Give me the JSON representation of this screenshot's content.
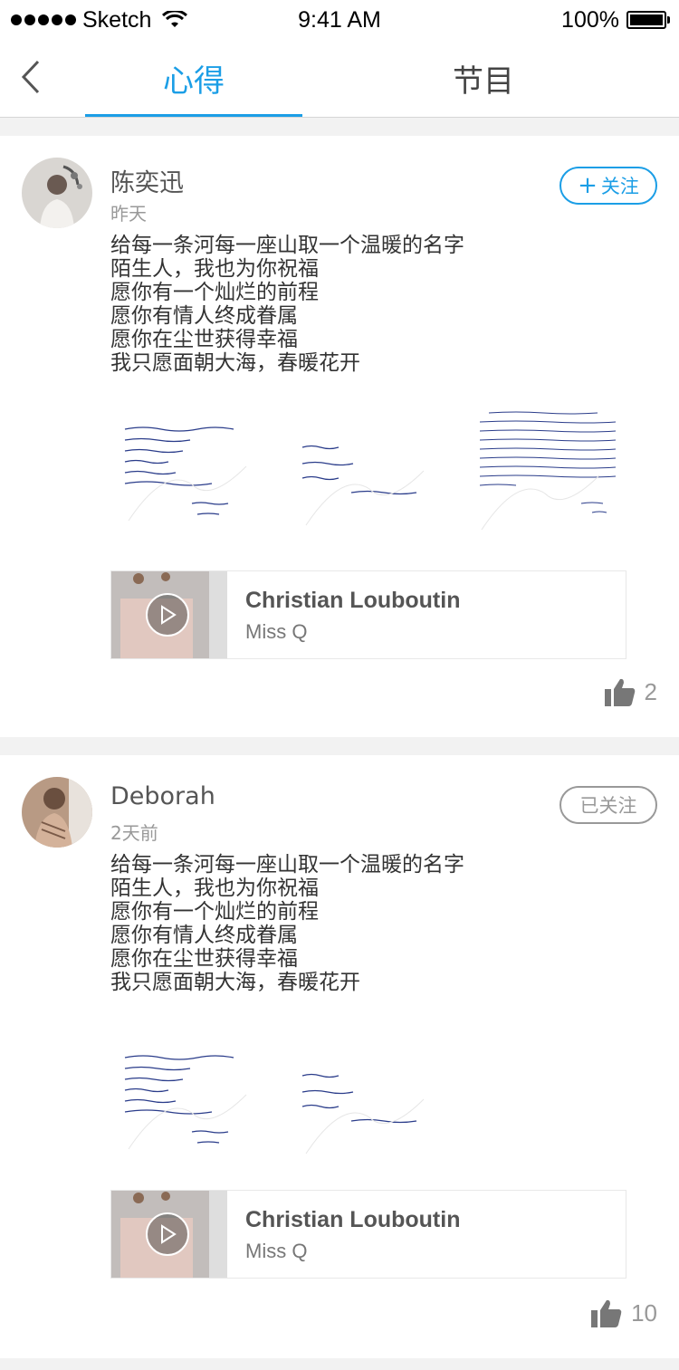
{
  "status_bar": {
    "carrier": "Sketch",
    "time": "9:41 AM",
    "battery": "100%"
  },
  "nav": {
    "tabs": [
      "心得",
      "节目"
    ],
    "active_tab": "心得"
  },
  "colors": {
    "accent": "#1b9ee6",
    "followed": "#999999"
  },
  "posts": [
    {
      "user": "陈奕迅",
      "time": "昨天",
      "follow_label": "关注",
      "followed": false,
      "lines": [
        "给每一条河每一座山取一个温暖的名字",
        "陌生人，我也为你祝福",
        "愿你有一个灿烂的前程",
        "愿你有情人终成眷属",
        "愿你在尘世获得幸福",
        "我只愿面朝大海，春暖花开"
      ],
      "music": {
        "title": "Christian Louboutin",
        "artist": "Miss Q"
      },
      "likes": "2"
    },
    {
      "user": "Deborah",
      "time": "2天前",
      "follow_label": "已关注",
      "followed": true,
      "lines": [
        "给每一条河每一座山取一个温暖的名字",
        "陌生人，我也为你祝福",
        "愿你有一个灿烂的前程",
        "愿你有情人终成眷属",
        "愿你在尘世获得幸福",
        "我只愿面朝大海，春暖花开"
      ],
      "music": {
        "title": "Christian Louboutin",
        "artist": "Miss Q"
      },
      "likes": "10"
    }
  ]
}
